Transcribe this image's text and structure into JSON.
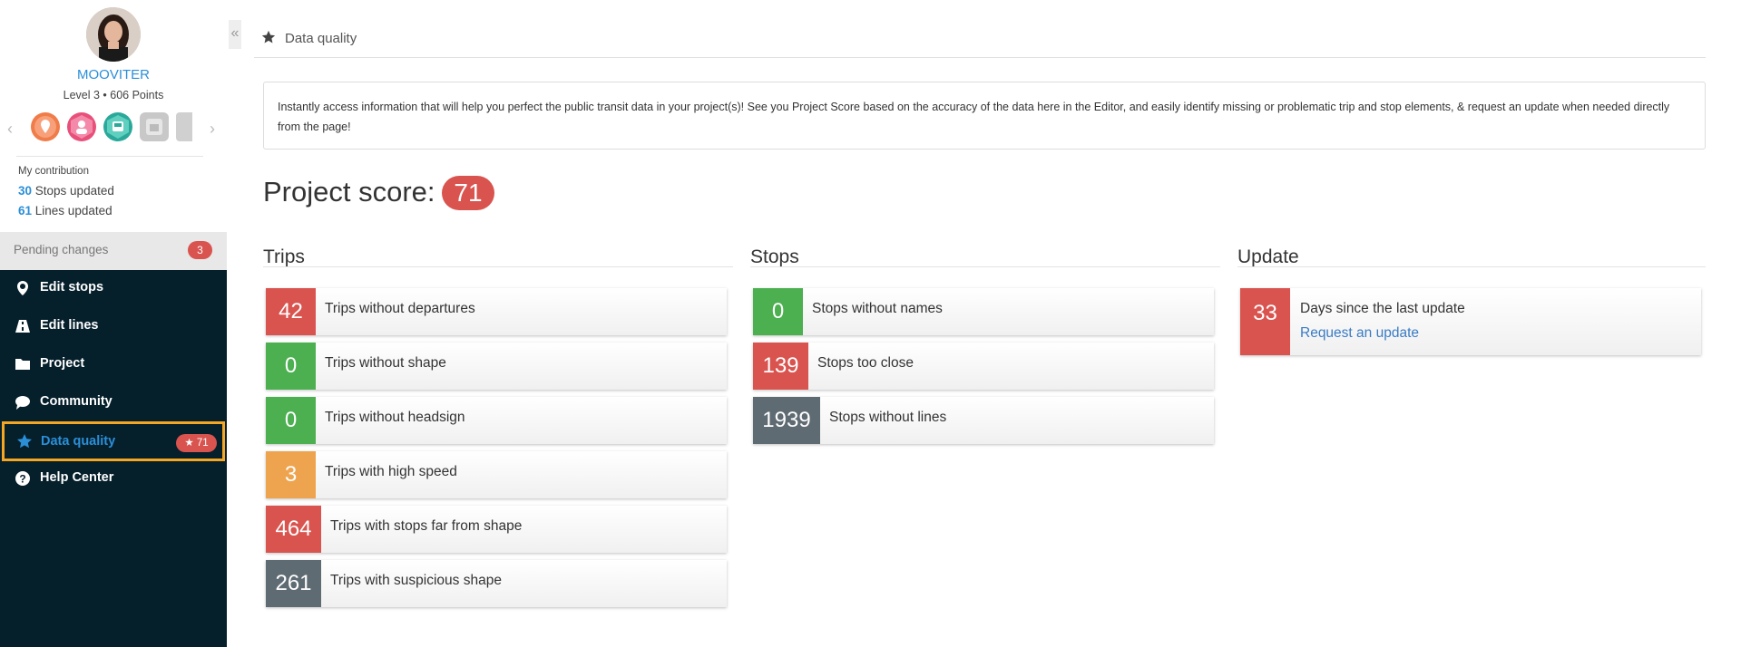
{
  "sidebar": {
    "username": "MOOVITER",
    "level": "Level 3 • 606 Points",
    "contribution_title": "My contribution",
    "stops_count": "30",
    "stops_label": " Stops updated",
    "lines_count": "61",
    "lines_label": " Lines updated",
    "pending_label": "Pending changes",
    "pending_count": "3",
    "nav": [
      {
        "label": "Edit stops",
        "icon": "map-pin-icon"
      },
      {
        "label": "Edit lines",
        "icon": "road-icon"
      },
      {
        "label": "Project",
        "icon": "folder-icon"
      },
      {
        "label": "Community",
        "icon": "chat-bubble-icon"
      },
      {
        "label": "Data quality",
        "icon": "star-icon",
        "badge": "★ 71"
      },
      {
        "label": "Help Center",
        "icon": "question-circle-icon"
      }
    ],
    "badges": [
      {
        "color": "#f07c4a",
        "icon": "map-pin-badge-icon"
      },
      {
        "color": "#e8507a",
        "icon": "person-badge-icon"
      },
      {
        "color": "#2aa89a",
        "icon": "bus-badge-icon"
      },
      {
        "color": "#c8c8c8",
        "icon": "locked-badge-icon"
      },
      {
        "color": "#d0d0d0",
        "icon": "locked-badge-icon"
      }
    ]
  },
  "header": {
    "title": "Data quality",
    "icon": "star-icon"
  },
  "info_text": "Instantly access information that will help you perfect the public transit data in your project(s)! See you Project Score based on the accuracy of the data here in the Editor, and easily identify missing or problematic trip and stop elements, & request an update when needed directly from the page!",
  "score": {
    "label": "Project score:",
    "value": "71"
  },
  "trips": {
    "title": "Trips",
    "items": [
      {
        "value": "42",
        "label": "Trips without departures",
        "color": "red"
      },
      {
        "value": "0",
        "label": "Trips without shape",
        "color": "green"
      },
      {
        "value": "0",
        "label": "Trips without headsign",
        "color": "green"
      },
      {
        "value": "3",
        "label": "Trips with high speed",
        "color": "orange"
      },
      {
        "value": "464",
        "label": "Trips with stops far from shape",
        "color": "red"
      },
      {
        "value": "261",
        "label": "Trips with suspicious shape",
        "color": "gray"
      }
    ]
  },
  "stops": {
    "title": "Stops",
    "items": [
      {
        "value": "0",
        "label": "Stops without names",
        "color": "green"
      },
      {
        "value": "139",
        "label": "Stops too close",
        "color": "red"
      },
      {
        "value": "1939",
        "label": "Stops without lines",
        "color": "gray"
      }
    ]
  },
  "update": {
    "title": "Update",
    "value": "33",
    "label": "Days since the last update",
    "link": "Request an update"
  },
  "colors": {
    "accent": "#2b8fd8",
    "red": "#d9534f",
    "green": "#4caf50",
    "orange": "#eea44f",
    "gray": "#5f6b73",
    "sidebar": "#051f2b",
    "highlight": "#f5a623"
  }
}
